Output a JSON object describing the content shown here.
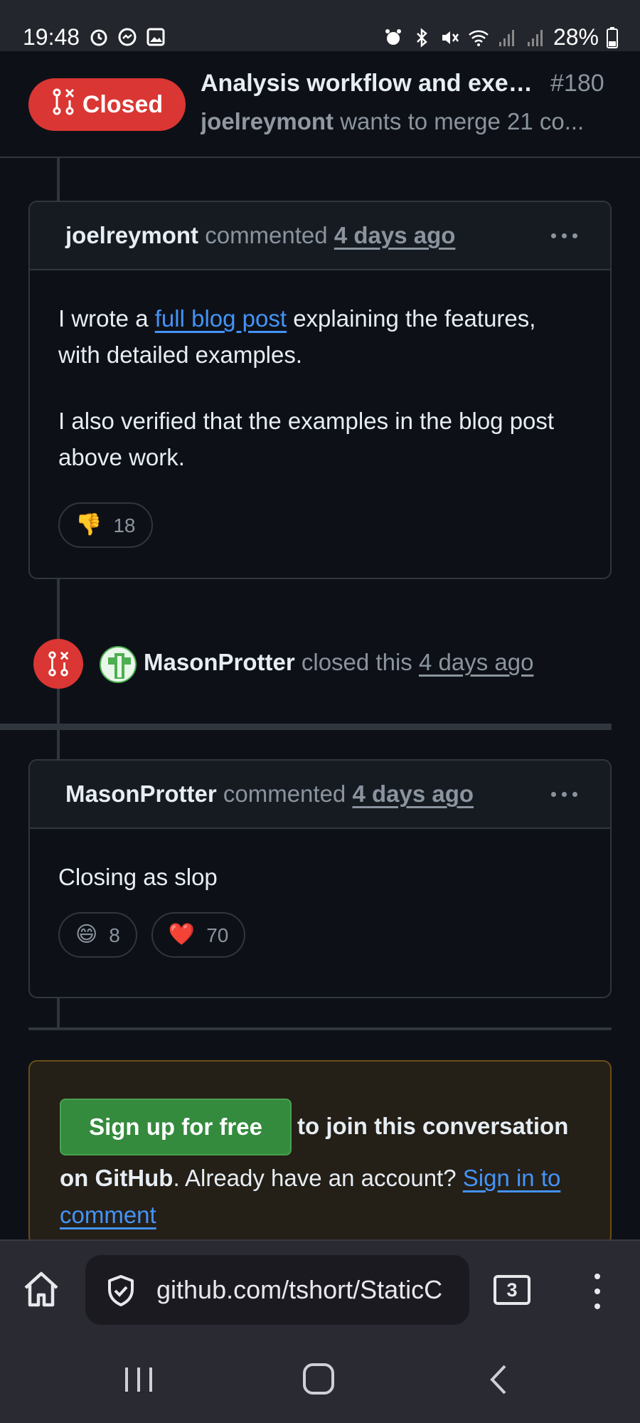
{
  "status_bar": {
    "time": "19:48",
    "battery": "28%",
    "left_icons": [
      "alarm-icon",
      "messenger-icon",
      "gallery-icon"
    ],
    "right_icons": [
      "alarm-icon",
      "bluetooth-icon",
      "mute-icon",
      "wifi-icon",
      "signal-icon",
      "signal-icon",
      "battery-icon"
    ]
  },
  "header": {
    "state": "Closed",
    "title": "Analysis workflow and exec...",
    "number": "#180",
    "author": "joelreymont",
    "summary": "wants to merge 21 co..."
  },
  "comments": [
    {
      "author": "joelreymont",
      "verb": "commented",
      "time": "4 days ago",
      "body": {
        "p1_before": "I wrote a ",
        "p1_link": "full blog post",
        "p1_after": " explaining the features, with detailed examples.",
        "p2": "I also verified that the examples in the blog post above work."
      },
      "reactions": [
        {
          "emoji": "👎",
          "name": "thumbs-down",
          "count": "18"
        }
      ]
    },
    {
      "author": "MasonProtter",
      "verb": "commented",
      "time": "4 days ago",
      "body": {
        "p1": "Closing as slop"
      },
      "reactions": [
        {
          "emoji": "😄",
          "name": "laugh",
          "count": "8"
        },
        {
          "emoji": "❤️",
          "name": "heart",
          "count": "70"
        }
      ]
    }
  ],
  "event": {
    "actor": "MasonProtter",
    "action": "closed this",
    "time": "4 days ago"
  },
  "signup": {
    "button": "Sign up for free",
    "text1": "to join this conversation",
    "text2_bold": "on GitHub",
    "text2_rest": ". Already have an account? ",
    "signin_link": "Sign in to comment"
  },
  "browser": {
    "url": "github.com/tshort/StaticC",
    "tab_count": "3"
  },
  "colors": {
    "background": "#0d1117",
    "closed_red": "#da3633",
    "link_blue": "#4493f8",
    "signup_green": "#348a3d"
  }
}
